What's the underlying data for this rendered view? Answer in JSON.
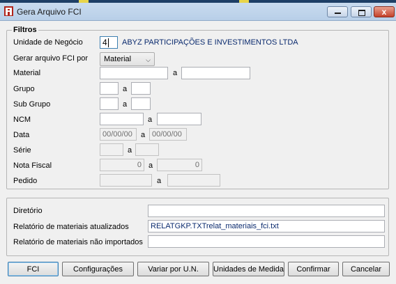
{
  "window": {
    "title": "Gera Arquivo FCI",
    "close_glyph": "x"
  },
  "filters": {
    "legend": "Filtros",
    "unidade_negocio": {
      "label": "Unidade de Negócio",
      "code": "4",
      "name": "ABYZ PARTICIPAÇÕES E INVESTIMENTOS LTDA"
    },
    "gerar_por": {
      "label": "Gerar arquivo FCI por",
      "selected": "Material"
    },
    "range_sep": "a",
    "material": {
      "label": "Material",
      "from": "",
      "to": ""
    },
    "grupo": {
      "label": "Grupo",
      "from": "",
      "to": ""
    },
    "sub_grupo": {
      "label": "Sub Grupo",
      "from": "",
      "to": ""
    },
    "ncm": {
      "label": "NCM",
      "from": "",
      "to": ""
    },
    "data": {
      "label": "Data",
      "from": "00/00/00",
      "to": "00/00/00"
    },
    "serie": {
      "label": "Série",
      "from": "",
      "to": ""
    },
    "nota_fiscal": {
      "label": "Nota Fiscal",
      "from": "0",
      "to": "0"
    },
    "pedido": {
      "label": "Pedido",
      "from": "",
      "to": ""
    }
  },
  "output": {
    "diretorio": {
      "label": "Diretório",
      "value": ""
    },
    "rel_atualizados": {
      "label": "Relatório de materiais atualizados",
      "value": "RELATGKP.TXTrelat_materiais_fci.txt"
    },
    "rel_nao_importados": {
      "label": "Relatório de materiais não importados",
      "value": ""
    }
  },
  "buttons": {
    "fci": "FCI",
    "configuracoes": "Configurações",
    "variar": "Variar por U.N.",
    "unidades": "Unidades de Medida",
    "confirmar": "Confirmar",
    "cancelar": "Cancelar"
  },
  "colors": {
    "title_bar": "#c9dbef",
    "accent_text": "#0a2a6e",
    "close_button": "#c4412a",
    "app_icon": "#b0241b"
  }
}
